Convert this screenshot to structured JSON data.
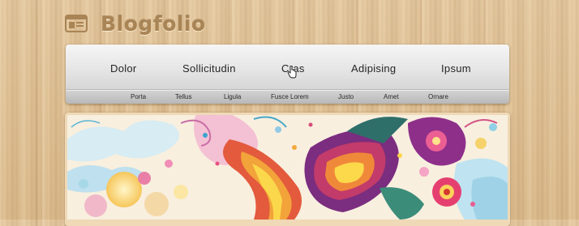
{
  "site": {
    "title": "Blogfolio",
    "logo_icon": "layout-window-icon"
  },
  "main_nav": [
    {
      "label": "Dolor"
    },
    {
      "label": "Sollicitudin"
    },
    {
      "label": "Cras"
    },
    {
      "label": "Adipising"
    },
    {
      "label": "Ipsum"
    }
  ],
  "sub_nav": [
    {
      "label": "Porta"
    },
    {
      "label": "Tellus"
    },
    {
      "label": "Ligula"
    },
    {
      "label": "Fusce Lorem"
    },
    {
      "label": "Justo"
    },
    {
      "label": "Amet"
    },
    {
      "label": "Ornare"
    }
  ],
  "colors": {
    "wood": "#e2c294",
    "logo_text": "#a98455",
    "menu_bg": "#ececec",
    "submenu_bg": "#c4c4c4",
    "menu_text": "#262626"
  }
}
